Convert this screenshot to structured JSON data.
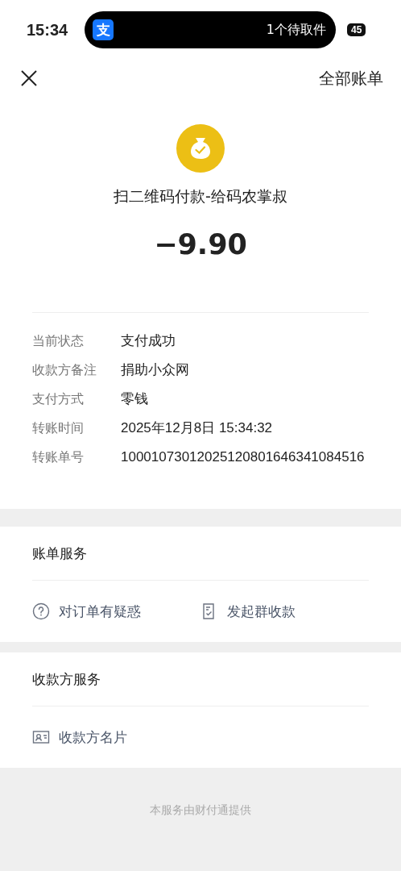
{
  "status_bar": {
    "time": "15:34",
    "island_app_glyph": "支",
    "island_text": "1个待取件",
    "battery": "45"
  },
  "nav": {
    "right_link": "全部账单"
  },
  "summary": {
    "title": "扫二维码付款-给码农掌叔",
    "amount": "−9.90"
  },
  "details": [
    {
      "label": "当前状态",
      "value": "支付成功"
    },
    {
      "label": "收款方备注",
      "value": "捐助小众网"
    },
    {
      "label": "支付方式",
      "value": "零钱"
    },
    {
      "label": "转账时间",
      "value": "2025年12月8日 15:34:32"
    },
    {
      "label": "转账单号",
      "value": "10001073012025120801646341084516"
    }
  ],
  "sections": [
    {
      "title": "账单服务",
      "actions": [
        {
          "kind": "question",
          "label": "对订单有疑惑"
        },
        {
          "kind": "bill",
          "label": "发起群收款"
        }
      ]
    },
    {
      "title": "收款方服务",
      "actions": [
        {
          "kind": "card",
          "label": "收款方名片"
        }
      ]
    }
  ],
  "footer": "本服务由财付通提供"
}
